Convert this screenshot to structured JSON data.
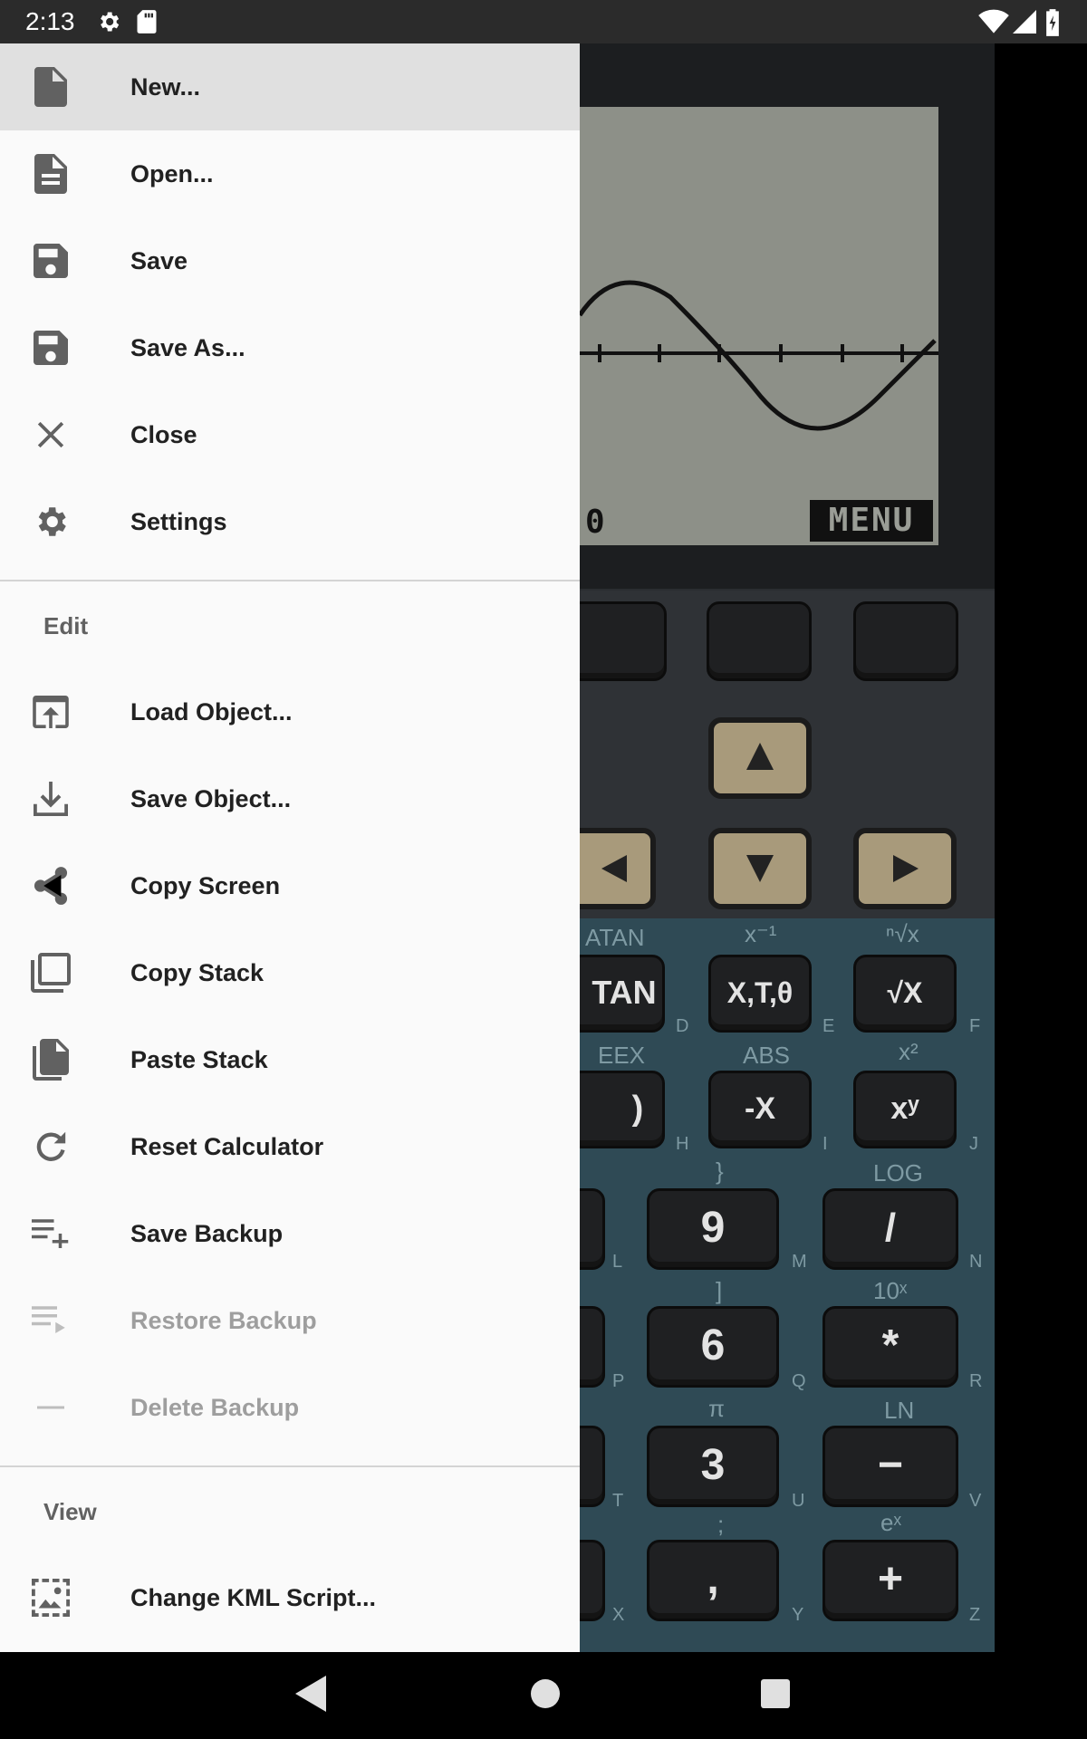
{
  "status_bar": {
    "time": "2:13",
    "icons": [
      "gear-icon",
      "sd-card-icon",
      "wifi-icon",
      "signal-icon",
      "battery-icon"
    ]
  },
  "calculator": {
    "lcd_menu": "MENU",
    "lcd_zero": "0",
    "keys": {
      "tan": "TAN",
      "xtheta": "X,T,θ",
      "sqrt": "√X",
      "paren": ")",
      "neg": "-X",
      "pow": "xʸ",
      "nine": "9",
      "div": "/",
      "six": "6",
      "mul": "*",
      "three": "3",
      "minus": "−",
      "comma": ",",
      "plus": "+"
    },
    "key_labels": {
      "atan": "ATAN",
      "xinv": "x⁻¹",
      "nroot": "ⁿ√x",
      "eex": "EEX",
      "abs": "ABS",
      "xsq": "x²",
      "log": "LOG",
      "tenx": "10ˣ",
      "pi": "π",
      "ln": "LN",
      "ex": "eˣ",
      "brace": "}",
      "bracket": "]",
      "semicolon": ";",
      "letters": [
        "D",
        "E",
        "F",
        "H",
        "I",
        "J",
        "L",
        "M",
        "N",
        "P",
        "Q",
        "R",
        "T",
        "U",
        "V",
        "X",
        "Y",
        "Z"
      ]
    }
  },
  "drawer": {
    "items": [
      {
        "label": "New...",
        "icon": "file-icon",
        "selected": true
      },
      {
        "label": "Open...",
        "icon": "document-icon"
      },
      {
        "label": "Save",
        "icon": "floppy-icon"
      },
      {
        "label": "Save As...",
        "icon": "floppy-icon"
      },
      {
        "label": "Close",
        "icon": "close-icon"
      },
      {
        "label": "Settings",
        "icon": "gear-icon"
      }
    ],
    "edit_header": "Edit",
    "edit_items": [
      {
        "label": "Load Object...",
        "icon": "upload-icon"
      },
      {
        "label": "Save Object...",
        "icon": "download-icon"
      },
      {
        "label": "Copy Screen",
        "icon": "share-icon"
      },
      {
        "label": "Copy Stack",
        "icon": "copy-icon"
      },
      {
        "label": "Paste Stack",
        "icon": "paste-icon"
      },
      {
        "label": "Reset Calculator",
        "icon": "refresh-icon"
      },
      {
        "label": "Save Backup",
        "icon": "playlist-add-icon"
      },
      {
        "label": "Restore Backup",
        "icon": "playlist-play-icon",
        "disabled": true
      },
      {
        "label": "Delete Backup",
        "icon": "minus-icon",
        "disabled": true
      }
    ],
    "view_header": "View",
    "view_items": [
      {
        "label": "Change KML Script...",
        "icon": "image-select-icon"
      }
    ]
  },
  "nav_bar": {
    "icons": [
      "back-icon",
      "home-icon",
      "recents-icon"
    ]
  }
}
